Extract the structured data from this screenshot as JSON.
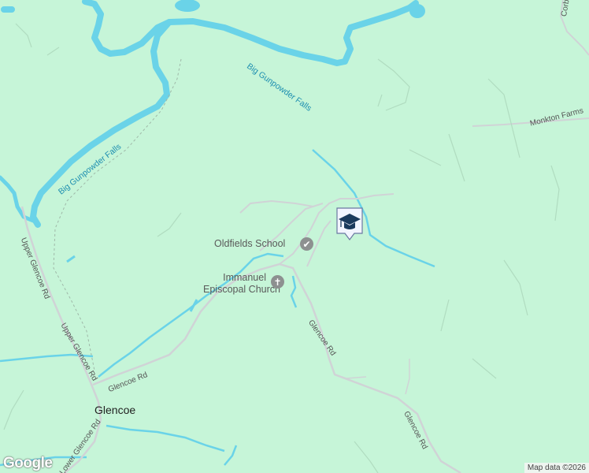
{
  "map": {
    "pois": [
      {
        "id": "oldfields",
        "name": "Oldfields School"
      },
      {
        "id": "immanuel",
        "line1": "Immanuel",
        "line2": "Episcopal Church"
      }
    ],
    "rivers": [
      "Big Gunpowder Falls",
      "Big Gunpowder Falls"
    ],
    "roads": [
      "Upper Glencoe Rd",
      "Upper Glencoe Rd",
      "Glencoe Rd",
      "Glencoe Rd",
      "Glencoe Rd",
      "Lower Glencoe Rd",
      "Monkton Farms",
      "Corb"
    ],
    "town": "Glencoe",
    "pin_icon": "school-cap-icon",
    "colors": {
      "land": "#c6f5d8",
      "water": "#6ad3e8",
      "road": "#d0d3d6",
      "pin": "#1a3a5c"
    }
  },
  "footer": {
    "logo": "Google",
    "attribution": "Map data ©2026"
  }
}
